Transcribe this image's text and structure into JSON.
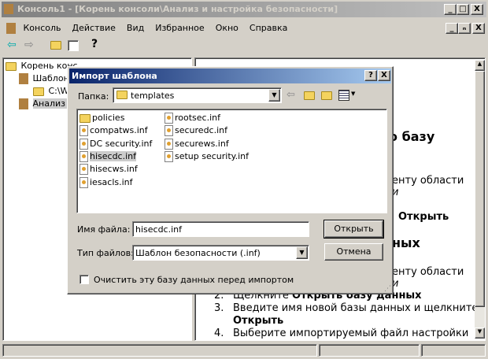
{
  "window": {
    "title": "Консоль1 - [Корень консоли\\Анализ и настройка безопасности]",
    "min": "_",
    "max": "□",
    "close": "X",
    "restore": "ₙ"
  },
  "menu": [
    "Консоль",
    "Действие",
    "Вид",
    "Избранное",
    "Окно",
    "Справка"
  ],
  "tree": [
    "Корень конс",
    "Шаблоны",
    "C:\\W",
    "Анализ и"
  ],
  "right_pane": {
    "frag1": "о базу",
    "frag2": "енту области",
    "frag3": "и",
    "frag4": "Открыть",
    "frag5": "ных",
    "frag6": "енту области",
    "frag7": "и",
    "step2_num": "2.",
    "step2": "Щелкните ",
    "step2_bold": "Открыть базу данных",
    "step3_num": "3.",
    "step3": "Введите имя новой базы данных и щелкните",
    "step3_bold": "Открыть",
    "step4_num": "4.",
    "step4": "Выберите импортируемый файл настройки"
  },
  "dialog": {
    "title": "Импорт шаблона",
    "help": "?",
    "close": "X",
    "folder_label": "Папка:",
    "folder_value": "templates",
    "files_col1": [
      "policies",
      "compatws.inf",
      "DC security.inf",
      "hisecdc.inf",
      "hisecws.inf",
      "iesacls.inf"
    ],
    "files_col2": [
      "rootsec.inf",
      "securedc.inf",
      "securews.inf",
      "setup security.inf"
    ],
    "filename_label": "Имя файла:",
    "filename_value": "hisecdc.inf",
    "filetype_label": "Тип файлов:",
    "filetype_value": "Шаблон безопасности (.inf)",
    "open": "Открыть",
    "cancel": "Отмена",
    "clear_checkbox": "Очистить эту базу данных перед импортом"
  }
}
